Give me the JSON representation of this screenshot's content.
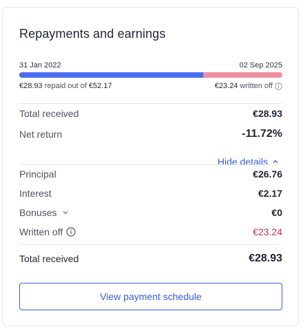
{
  "title": "Repayments and earnings",
  "timeline": {
    "start_date": "31 Jan 2022",
    "end_date": "02 Sep 2025",
    "repaid_fraction": 0.7
  },
  "bar_meta": {
    "repaid_amount": "€28.93",
    "repaid_text": "repaid out of",
    "total_amount": "€52.17",
    "written_off_amount": "€23.24",
    "written_off_text": "written off"
  },
  "summary": {
    "total_received_label": "Total received",
    "total_received_value": "€28.93",
    "net_return_label": "Net return",
    "net_return_value": "-11.72%"
  },
  "toggle": {
    "label": "Hide details"
  },
  "details": {
    "principal_label": "Principal",
    "principal_value": "€26.76",
    "interest_label": "Interest",
    "interest_value": "€2.17",
    "bonuses_label": "Bonuses",
    "bonuses_value": "€0",
    "written_off_label": "Written off",
    "written_off_value": "€23.24"
  },
  "footer": {
    "total_received_label": "Total received",
    "total_received_value": "€28.93"
  },
  "button": {
    "label": "View payment schedule"
  },
  "colors": {
    "accent": "#3a5ce0",
    "repaid_bar": "#4c6ef0",
    "written_off_bar": "#ef8fa0",
    "negative": "#c8334f"
  }
}
